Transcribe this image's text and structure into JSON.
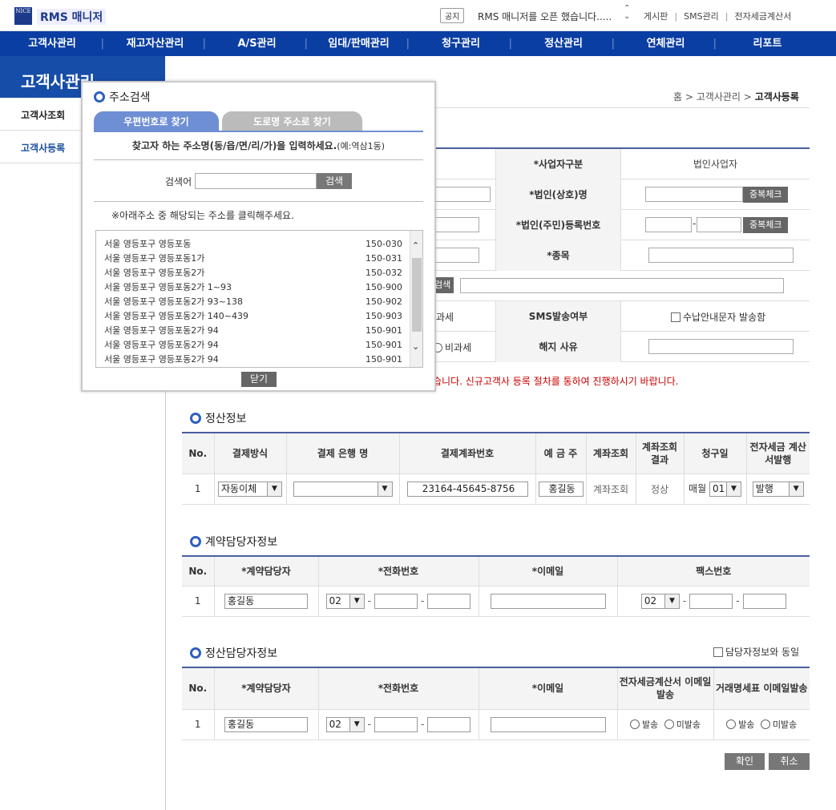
{
  "header": {
    "logo_mark": "NICE",
    "app_title": "RMS 매니저",
    "notice_badge": "공지",
    "notice_text": "RMS 매니저를 오픈 했습니다.....",
    "links": [
      "게시판",
      "SMS관리",
      "전자세금계산서"
    ]
  },
  "nav": [
    "고객사관리",
    "재고자산관리",
    "A/S관리",
    "임대/판매관리",
    "청구관리",
    "정산관리",
    "연체관리",
    "리포트"
  ],
  "sidebar": {
    "title": "고객사관리",
    "items": [
      {
        "label": "고객사조회",
        "active": false
      },
      {
        "label": "고객사등록",
        "active": true
      }
    ]
  },
  "breadcrumb": {
    "home": "홈",
    "sep": ">",
    "section": "고객사관리",
    "current": "고객사등록"
  },
  "form": {
    "biz_type_label": "*사업자구분",
    "biz_type_value": "법인사업자",
    "corp_name_label": "*법인(상호)명",
    "dup_check_label": "중복체크",
    "reg_no_label": "*법인(주민)등록번호",
    "dash": "-",
    "item_label": "*종목",
    "search_fragment": "검색",
    "tax_fragment": "과세",
    "sms_label": "SMS발송여부",
    "sms_option": "수납안내문자 발송함",
    "nontax_label": "비과세",
    "termination_label": "해지 사유",
    "warning": "습니다. 신규고객사 등록 절차를 통하여 진행하시기 바랍니다."
  },
  "settlement": {
    "title": "정산정보",
    "headers": [
      "No.",
      "결제방식",
      "결제 은행 명",
      "결제계좌번호",
      "예 금 주",
      "계좌조회",
      "계좌조회 결과",
      "청구일",
      "전자세금 계산서발행"
    ],
    "row": {
      "no": "1",
      "method": "자동이체",
      "bank": "",
      "account": "23164-45645-8756",
      "holder": "홍길동",
      "check": "계좌조회",
      "result": "정상",
      "bill_prefix": "매월",
      "bill_day": "01",
      "invoice": "발행"
    }
  },
  "contract": {
    "title": "계약담당자정보",
    "headers": [
      "No.",
      "*계약담당자",
      "*전화번호",
      "*이메일",
      "팩스번호"
    ],
    "row": {
      "no": "1",
      "name": "홍길동",
      "phone_prefix": "02",
      "fax_prefix": "02"
    }
  },
  "settle_manager": {
    "title": "정산담당자정보",
    "same_label": "담당자정보와 동일",
    "headers": [
      "No.",
      "*계약담당자",
      "*전화번호",
      "*이메일",
      "전자세금계산서 이메일발송",
      "거래명세표 이메일발송"
    ],
    "row": {
      "no": "1",
      "name": "홍길동",
      "phone_prefix": "02"
    },
    "send": "발송",
    "nosend": "미발송"
  },
  "actions": {
    "confirm": "확인",
    "cancel": "취소"
  },
  "popup": {
    "title": "주소검색",
    "tab_zip": "우편번호로 찾기",
    "tab_road": "도로명 주소로 찾기",
    "instruction": "찾고자 하는 주소명(동/읍/면/리/가)을 입력하세요.",
    "instruction_example": "(예:역삼1동)",
    "search_label": "검색어",
    "search_button": "검색",
    "note": "※아래주소 중 해당되는 주소를 클릭해주세요.",
    "results": [
      {
        "addr": "서울 영등포구 영등포동",
        "zip": "150-030"
      },
      {
        "addr": "서울 영등포구 영등포동1가",
        "zip": "150-031"
      },
      {
        "addr": "서울 영등포구 영등포동2가",
        "zip": "150-032"
      },
      {
        "addr": "서울 영등포구 영등포동2가 1~93",
        "zip": "150-900"
      },
      {
        "addr": "서울 영등포구 영등포동2가 93~138",
        "zip": "150-902"
      },
      {
        "addr": "서울 영등포구 영등포동2가 140~439",
        "zip": "150-903"
      },
      {
        "addr": "서울 영등포구 영등포동2가 94",
        "zip": "150-901"
      },
      {
        "addr": "서울 영등포구 영등포동2가 94",
        "zip": "150-901"
      },
      {
        "addr": "서울 영등포구 영등포동2가 94",
        "zip": "150-901"
      }
    ],
    "close_button": "닫기"
  }
}
